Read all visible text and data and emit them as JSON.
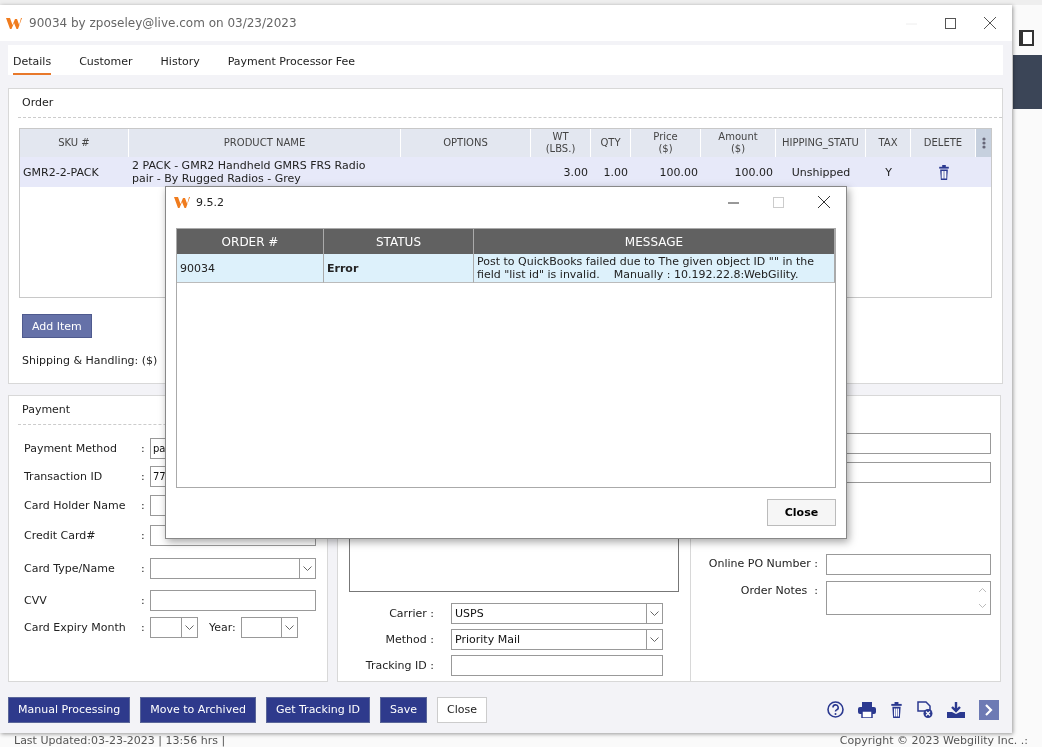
{
  "window": {
    "title": "90034 by zposeley@live.com on 03/23/2023"
  },
  "tabs": [
    {
      "label": "Details",
      "selected": true
    },
    {
      "label": "Customer",
      "selected": false
    },
    {
      "label": "History",
      "selected": false
    },
    {
      "label": "Payment Processor Fee",
      "selected": false
    }
  ],
  "order": {
    "title": "Order",
    "table": {
      "columns": [
        "SKU #",
        "PRODUCT NAME",
        "OPTIONS",
        "WT\n(LBS.)",
        "QTY",
        "Price\n($)",
        "Amount\n($)",
        "HIPPING_STATU",
        "TAX",
        "DELETE"
      ],
      "rows": [
        {
          "cells": [
            "GMR2-2-PACK",
            "2 PACK - GMR2 Handheld GMRS FRS Radio pair - By Rugged Radios - Grey",
            "",
            "3.00",
            "1.00",
            "100.00",
            "100.00",
            "Unshipped",
            "Y"
          ]
        }
      ]
    },
    "add_button": "Add Item",
    "shipping_label": "Shipping & Handling: ($)"
  },
  "payment": {
    "title": "Payment",
    "fields": [
      {
        "label": "Payment Method",
        "sep": ":",
        "kind": "text",
        "value": "pa"
      },
      {
        "label": "Transaction ID",
        "sep": ":",
        "kind": "text",
        "value": "77"
      },
      {
        "label": "Card Holder Name",
        "sep": ":",
        "kind": "text"
      },
      {
        "label": "Credit Card#",
        "sep": ":",
        "kind": "text"
      },
      {
        "label": "Card Type/Name",
        "sep": ":",
        "kind": "select"
      },
      {
        "label": "CVV",
        "sep": ":",
        "kind": "text"
      },
      {
        "label": "Card Expiry Month",
        "sep": ":",
        "kind": "expiry",
        "year_label": "Year:"
      }
    ]
  },
  "shipping": {
    "fields": [
      {
        "label": "Carrier :",
        "kind": "select",
        "value": "USPS"
      },
      {
        "label": "Method :",
        "kind": "select",
        "value": "Priority Mail"
      },
      {
        "label": "Tracking ID :",
        "kind": "text"
      }
    ]
  },
  "other": {
    "fields": [
      {
        "kind": "text"
      },
      {
        "kind": "text"
      },
      {
        "label": "Online PO Number :",
        "kind": "text"
      },
      {
        "label": "Order Notes  :",
        "kind": "textarea"
      }
    ]
  },
  "buttons": [
    {
      "label": "Manual Processing",
      "kind": "primary"
    },
    {
      "label": "Move to Archived",
      "kind": "primary"
    },
    {
      "label": "Get Tracking ID",
      "kind": "primary"
    },
    {
      "label": "Save",
      "kind": "primary"
    },
    {
      "label": "Close",
      "kind": "plain"
    }
  ],
  "status_bar": {
    "left": "Last Updated:03-23-2023 | 13:56 hrs |",
    "right": "Copyright © 2023 Webgility Inc. .:"
  },
  "dialog": {
    "title": "9.5.2",
    "table": {
      "columns": [
        "ORDER #",
        "STATUS",
        "MESSAGE"
      ],
      "rows": [
        {
          "cells": [
            "90034",
            "Error",
            "Post to QuickBooks failed due to The given object ID \"\" in the field \"list id\" is invalid.    Manually : 10.192.22.8:WebGility."
          ]
        }
      ]
    },
    "close_button": "Close"
  }
}
